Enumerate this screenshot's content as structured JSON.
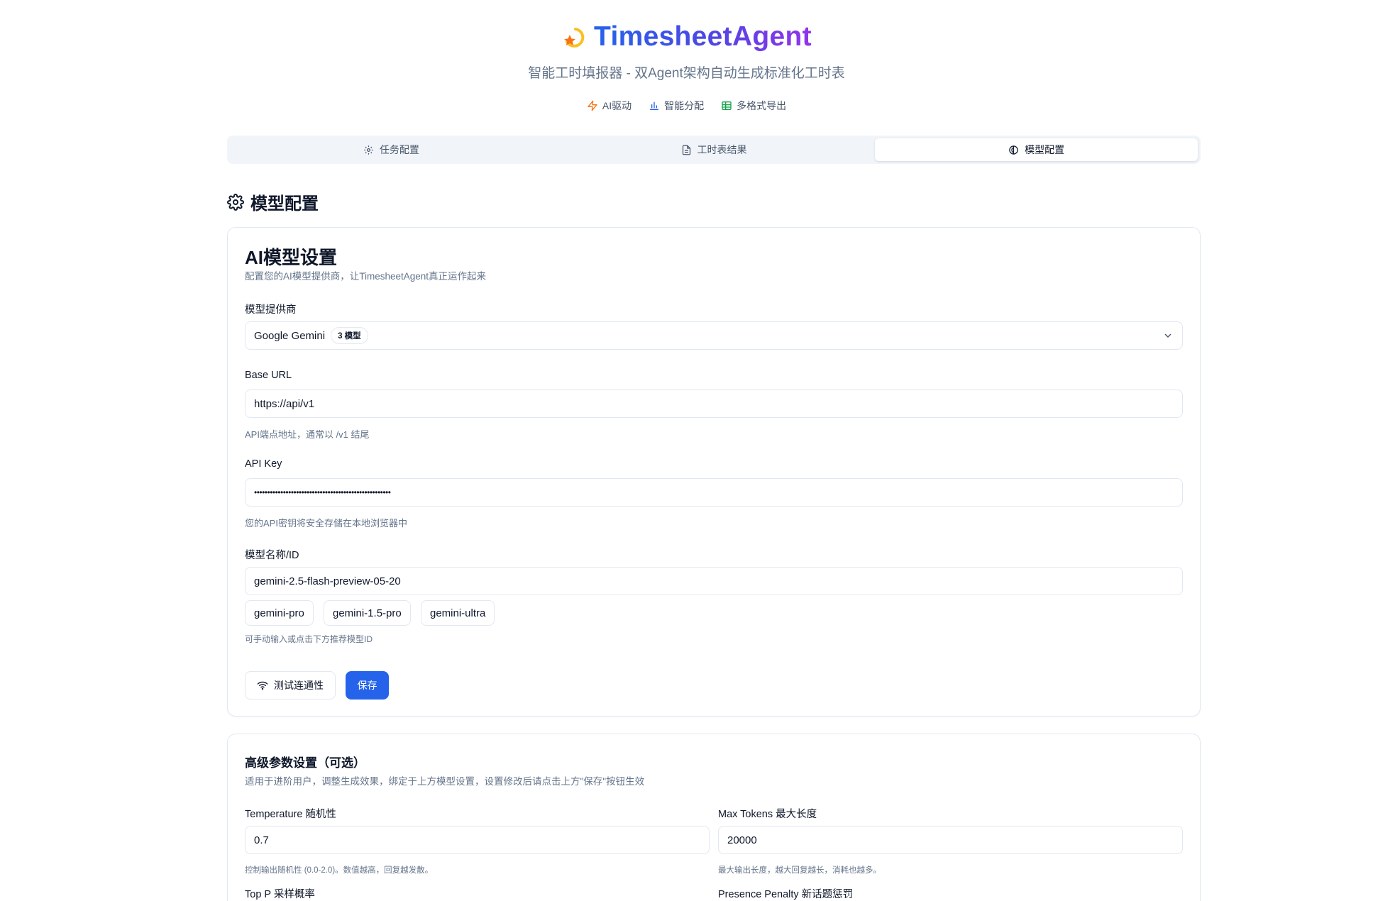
{
  "header": {
    "title": "TimesheetAgent",
    "subtitle": "智能工时填报器 - 双Agent架构自动生成标准化工时表",
    "features": [
      {
        "icon": "lightning-icon",
        "label": "AI驱动",
        "color": "#f97316"
      },
      {
        "icon": "bar-chart-icon",
        "label": "智能分配",
        "color": "#2563eb"
      },
      {
        "icon": "table-icon",
        "label": "多格式导出",
        "color": "#16a34a"
      }
    ]
  },
  "tabs": [
    {
      "icon": "gear-icon",
      "label": "任务配置",
      "active": false
    },
    {
      "icon": "document-icon",
      "label": "工时表结果",
      "active": false
    },
    {
      "icon": "brain-icon",
      "label": "模型配置",
      "active": true
    }
  ],
  "page": {
    "title": "模型配置"
  },
  "ai_settings": {
    "title": "AI模型设置",
    "description": "配置您的AI模型提供商，让TimesheetAgent真正运作起来",
    "provider": {
      "label": "模型提供商",
      "value": "Google Gemini",
      "badge": "3 模型"
    },
    "base_url": {
      "label": "Base URL",
      "value": "https://api/v1",
      "hint": "API端点地址，通常以 /v1 结尾"
    },
    "api_key": {
      "label": "API Key",
      "value": "••••••••••••••••••••••••••••••••••••••••••••••••••••",
      "hint": "您的API密钥将安全存储在本地浏览器中"
    },
    "model": {
      "label": "模型名称/ID",
      "value": "gemini-2.5-flash-preview-05-20",
      "suggestions": [
        "gemini-pro",
        "gemini-1.5-pro",
        "gemini-ultra"
      ],
      "hint": "可手动输入或点击下方推荐模型ID"
    },
    "test_button": "测试连通性",
    "save_button": "保存"
  },
  "advanced": {
    "title": "高级参数设置（可选）",
    "description": "适用于进阶用户，调整生成效果，绑定于上方模型设置，设置修改后请点击上方\"保存\"按钮生效",
    "temperature": {
      "label": "Temperature 随机性",
      "value": "0.7",
      "hint": "控制输出随机性 (0.0-2.0)。数值越高，回复越发散。"
    },
    "max_tokens": {
      "label": "Max Tokens 最大长度",
      "value": "20000",
      "hint": "最大输出长度，越大回复越长，消耗也越多。"
    },
    "top_p": {
      "label": "Top P 采样概率"
    },
    "presence_penalty": {
      "label": "Presence Penalty 新话题惩罚"
    }
  },
  "colors": {
    "primary": "#2563eb",
    "gradient_start": "#2563eb",
    "gradient_end": "#9333ea"
  }
}
